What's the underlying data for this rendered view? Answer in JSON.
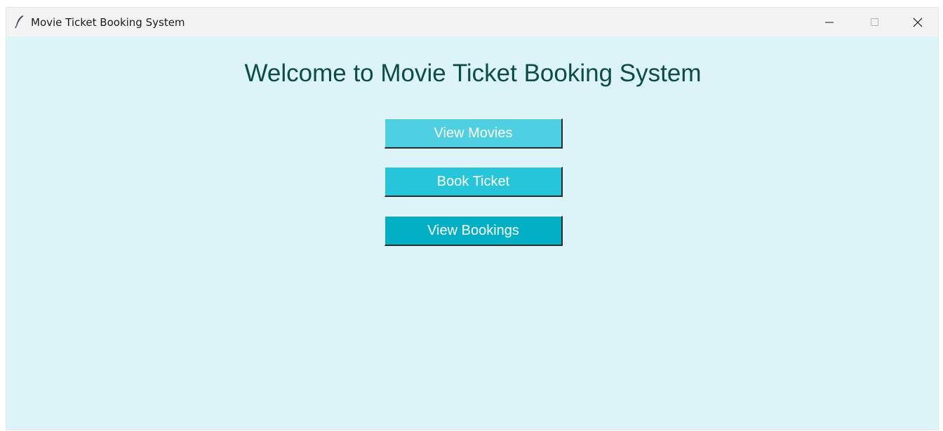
{
  "window": {
    "title": "Movie Ticket Booking System",
    "icon": "feather-icon",
    "controls": {
      "minimize_icon": "minimize-icon",
      "maximize_icon": "maximize-icon",
      "close_icon": "close-icon"
    }
  },
  "main": {
    "heading": "Welcome to Movie Ticket Booking System",
    "buttons": [
      {
        "label": "View Movies",
        "color": "#4ed0e2"
      },
      {
        "label": "Book Ticket",
        "color": "#26c5d9"
      },
      {
        "label": "View Bookings",
        "color": "#02afc4"
      }
    ]
  },
  "colors": {
    "background": "#dcf4f8",
    "heading": "#0b4d46",
    "titlebar": "#f3f3f3"
  }
}
